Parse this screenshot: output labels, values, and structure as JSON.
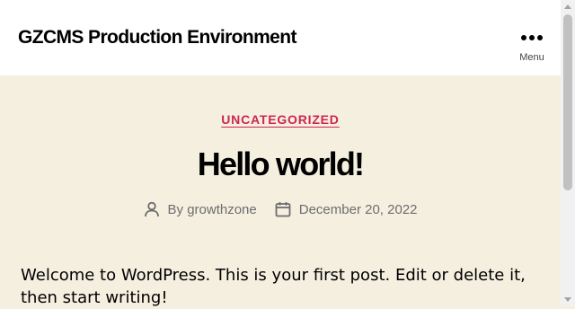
{
  "header": {
    "site_title": "GZCMS Production Environment",
    "menu_label": "Menu",
    "menu_icon": "three-dots-horizontal-icon"
  },
  "post": {
    "category": "UNCATEGORIZED",
    "title": "Hello world!",
    "author_prefix": "By",
    "author": "growthzone",
    "date": "December 20, 2022",
    "excerpt": "Welcome to WordPress. This is your first post. Edit or delete it, then start writing!"
  },
  "colors": {
    "accent": "#cd2653",
    "background": "#f5efe0",
    "header_background": "#ffffff",
    "meta_text": "#6d6d6d"
  },
  "icons": {
    "author": "user-icon",
    "date": "calendar-icon"
  }
}
